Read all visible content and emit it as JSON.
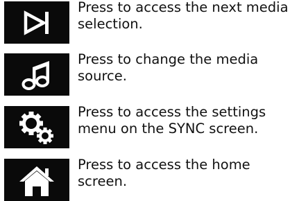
{
  "items": [
    {
      "icon": "next-media-icon",
      "line1": "Press to access the next media",
      "line2": "selection."
    },
    {
      "icon": "music-note-icon",
      "line1": "Press to change the media",
      "line2": "source."
    },
    {
      "icon": "settings-gears-icon",
      "line1": "Press to access the settings",
      "line2": "menu on the SYNC screen."
    },
    {
      "icon": "home-icon",
      "line1": "Press to access the home",
      "line2": "screen."
    }
  ],
  "colors": {
    "icon_background": "#0a0a0a",
    "icon_foreground": "#ffffff",
    "text": "#111111",
    "page_background": "#ffffff"
  }
}
